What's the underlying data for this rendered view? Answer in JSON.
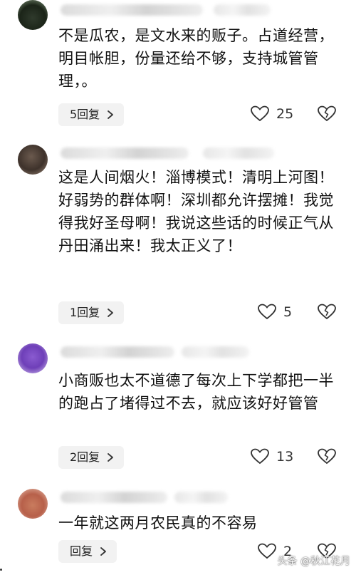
{
  "comments": [
    {
      "text": "不是瓜农，是文水来的贩子。占道经营，明目帐胆，份量还给不够，支持城管管理，。",
      "reply_label": "5回复",
      "likes": "25"
    },
    {
      "text": "这是人间烟火！淄博模式！清明上河图！好弱势的群体啊！深圳都允许摆摊！我觉得我好圣母啊！我说这些话的时候正气从丹田涌出来！我太正义了！",
      "reply_label": "1回复",
      "likes": "5"
    },
    {
      "text": "小商贩也太不道德了每次上下学都把一半的跑占了堵得过不去，就应该好好管管",
      "reply_label": "2回复",
      "likes": "13"
    },
    {
      "text": "一年就这两月农民真的不容易",
      "reply_label": "回复",
      "likes": "2"
    }
  ],
  "watermark": "头条 @秋江花月",
  "icons": {
    "like": "heart-outline-icon",
    "dislike": "broken-heart-icon",
    "chevron": "chevron-right-icon"
  }
}
